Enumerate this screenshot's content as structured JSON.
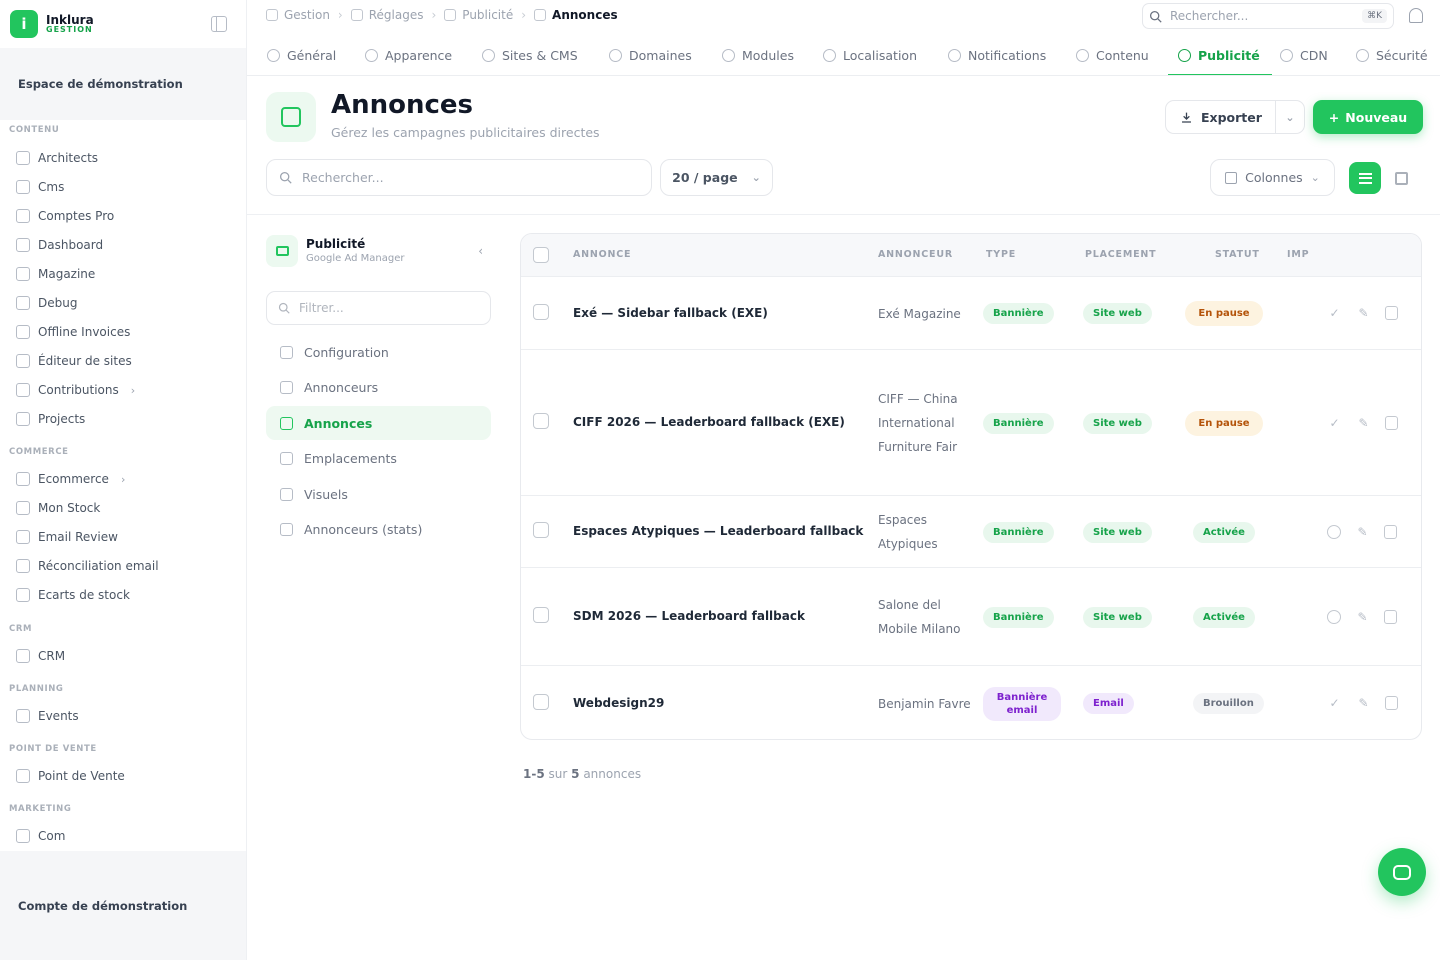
{
  "brand": {
    "logo_letter": "i",
    "name": "Inklura",
    "subtitle": "GESTION"
  },
  "workspace": "Espace de démonstration",
  "account": "Compte de démonstration",
  "sidebar": {
    "sections": [
      {
        "title": "CONTENU",
        "items": [
          {
            "label": "Architects",
            "icon": "building-icon"
          },
          {
            "label": "Cms",
            "icon": "document-icon"
          },
          {
            "label": "Comptes Pro",
            "icon": "document-icon"
          },
          {
            "label": "Dashboard",
            "icon": "grid-icon"
          },
          {
            "label": "Magazine",
            "icon": "book-icon"
          },
          {
            "label": "Debug",
            "icon": "book-icon"
          },
          {
            "label": "Offline Invoices",
            "icon": "book-icon"
          },
          {
            "label": "Éditeur de sites",
            "icon": "terminal-icon"
          },
          {
            "label": "Contributions",
            "icon": "folder-icon",
            "chevron": "›"
          },
          {
            "label": "Projects",
            "icon": "folder-icon"
          }
        ]
      },
      {
        "title": "COMMERCE",
        "items": [
          {
            "label": "Ecommerce",
            "icon": "cart-icon",
            "chevron": "›"
          },
          {
            "label": "Mon Stock",
            "icon": "cart-icon"
          },
          {
            "label": "Email Review",
            "icon": "cart-icon"
          },
          {
            "label": "Réconciliation email",
            "icon": "cart-icon"
          },
          {
            "label": "Ecarts de stock",
            "icon": "cart-icon"
          }
        ]
      },
      {
        "title": "CRM",
        "items": [
          {
            "label": "CRM",
            "icon": "user-icon"
          }
        ]
      },
      {
        "title": "PLANNING",
        "items": [
          {
            "label": "Events",
            "icon": "calendar-icon"
          }
        ]
      },
      {
        "title": "POINT DE VENTE",
        "items": [
          {
            "label": "Point de Vente",
            "icon": "register-icon"
          }
        ]
      },
      {
        "title": "MARKETING",
        "items": [
          {
            "label": "Com",
            "icon": "megaphone-icon"
          }
        ]
      }
    ]
  },
  "breadcrumb": [
    {
      "label": "Gestion",
      "icon": "home-icon"
    },
    {
      "label": "Réglages",
      "icon": "gear-icon"
    },
    {
      "label": "Publicité",
      "icon": "megaphone-icon"
    },
    {
      "label": "Annonces",
      "icon": "layout-icon",
      "current": true
    }
  ],
  "topbar": {
    "search_placeholder": "Rechercher...",
    "shortcut": "⌘K"
  },
  "tabs": [
    {
      "label": "Général"
    },
    {
      "label": "Apparence"
    },
    {
      "label": "Sites & CMS"
    },
    {
      "label": "Domaines"
    },
    {
      "label": "Modules"
    },
    {
      "label": "Localisation"
    },
    {
      "label": "Notifications"
    },
    {
      "label": "Contenu"
    },
    {
      "label": "Publicité",
      "active": true
    },
    {
      "label": "CDN"
    },
    {
      "label": "Sécurité"
    }
  ],
  "page": {
    "title": "Annonces",
    "subtitle": "Gérez les campagnes publicitaires directes",
    "export_label": "Exporter",
    "new_label": "Nouveau",
    "search_placeholder": "Rechercher...",
    "per_page": "20 / page",
    "columns_label": "Colonnes"
  },
  "subnav": {
    "title": "Publicité",
    "subtitle": "Google Ad Manager",
    "filter_placeholder": "Filtrer...",
    "items": [
      {
        "label": "Configuration"
      },
      {
        "label": "Annonceurs"
      },
      {
        "label": "Annonces",
        "active": true
      },
      {
        "label": "Emplacements"
      },
      {
        "label": "Visuels"
      },
      {
        "label": "Annonceurs (stats)"
      }
    ]
  },
  "table": {
    "headers": [
      "ANNONCE",
      "ANNONCEUR",
      "TYPE",
      "PLACEMENT",
      "STATUT",
      "IMP"
    ],
    "rows": [
      {
        "title": "Exé — Sidebar fallback (EXE)",
        "advertiser": "Exé Magazine",
        "type": "Bannière",
        "type_variant": "green",
        "placement": "Site web",
        "placement_variant": "green",
        "status": "En pause",
        "status_variant": "wait"
      },
      {
        "title": "CIFF 2026 — Leaderboard fallback (EXE)",
        "advertiser": "CIFF — China International Furniture Fair",
        "type": "Bannière",
        "type_variant": "green",
        "placement": "Site web",
        "placement_variant": "green",
        "status": "En pause",
        "status_variant": "wait"
      },
      {
        "title": "Espaces Atypiques — Leaderboard fallback",
        "advertiser": "Espaces Atypiques",
        "type": "Bannière",
        "type_variant": "green",
        "placement": "Site web",
        "placement_variant": "green",
        "status": "Activée",
        "status_variant": "active"
      },
      {
        "title": "SDM 2026 — Leaderboard fallback",
        "advertiser": "Salone del Mobile Milano",
        "type": "Bannière",
        "type_variant": "green",
        "placement": "Site web",
        "placement_variant": "green",
        "status": "Activée",
        "status_variant": "active"
      },
      {
        "title": "Webdesign29",
        "advertiser": "Benjamin Favre",
        "type": "Bannière email",
        "type_variant": "purple",
        "placement": "Email",
        "placement_variant": "purple",
        "status": "Brouillon",
        "status_variant": "draft"
      }
    ],
    "footer": {
      "range": "1-5",
      "of": "sur",
      "total": "5",
      "unit": "annonces"
    }
  },
  "colors": {
    "accent": "#22c55e",
    "accent_dark": "#16a34a",
    "purple": "#7e22ce",
    "warning": "#b45309"
  }
}
